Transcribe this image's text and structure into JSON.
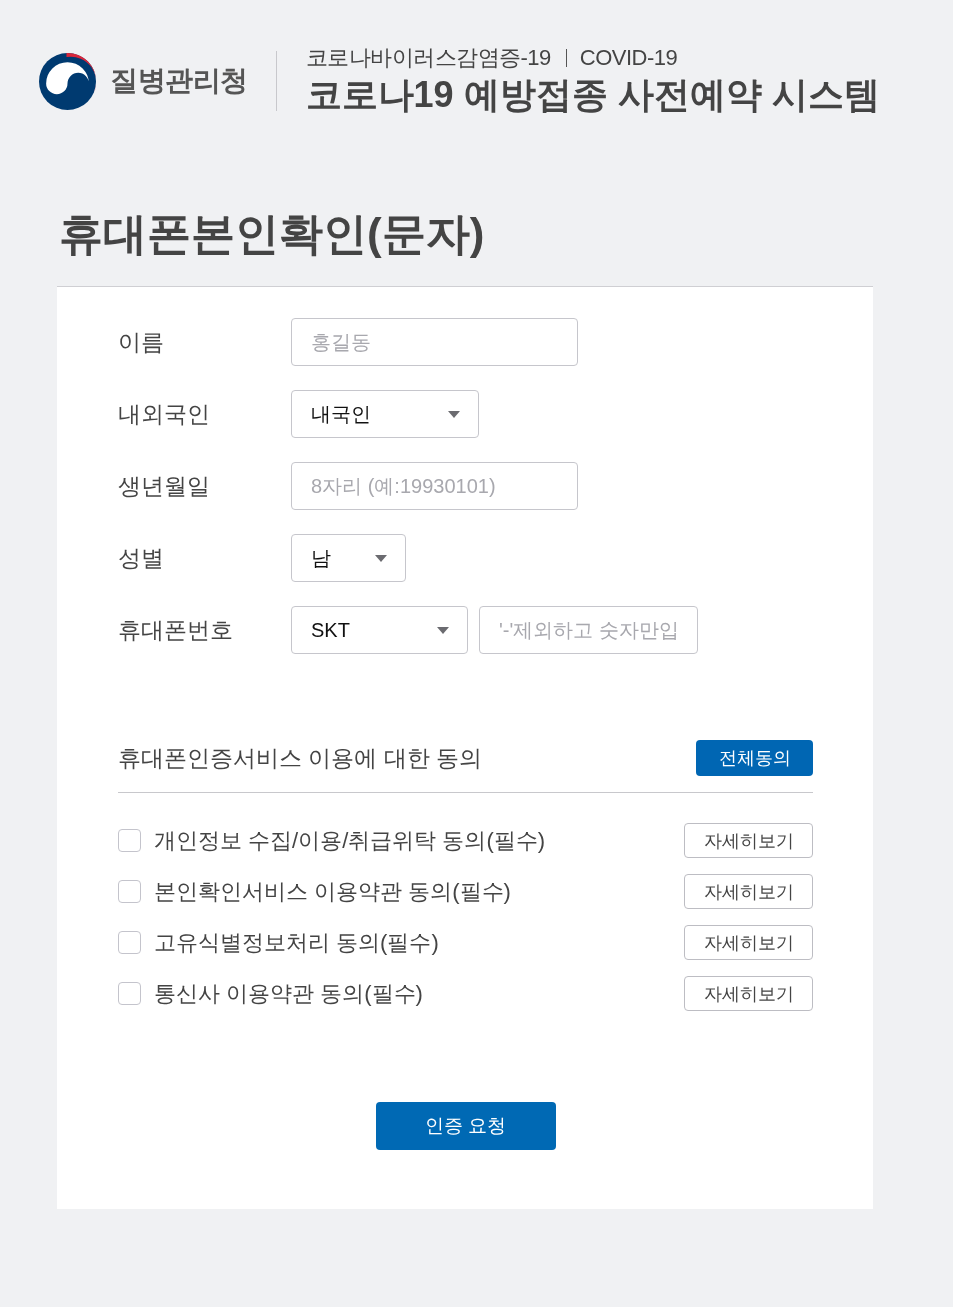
{
  "header": {
    "agency": "질병관리청",
    "subtitle": "코로나바이러스감염증-19",
    "subtitle_en": "COVID-19",
    "title": "코로나19 예방접종 사전예약 시스템"
  },
  "page_title": "휴대폰본인확인(문자)",
  "form": {
    "rows": [
      {
        "label": "이름",
        "fields": [
          {
            "kind": "input",
            "placeholder": "홍길동"
          }
        ]
      },
      {
        "label": "내외국인",
        "fields": [
          {
            "kind": "select",
            "value": "내국인"
          }
        ]
      },
      {
        "label": "생년월일",
        "fields": [
          {
            "kind": "input",
            "placeholder": "8자리 (예:19930101)"
          }
        ]
      },
      {
        "label": "성별",
        "fields": [
          {
            "kind": "select",
            "value": "남"
          }
        ]
      },
      {
        "label": "휴대폰번호",
        "fields": [
          {
            "kind": "select",
            "value": "SKT"
          },
          {
            "kind": "input",
            "placeholder": "'-'제외하고 숫자만입"
          }
        ]
      }
    ]
  },
  "consent": {
    "heading": "휴대폰인증서비스 이용에 대한 동의",
    "all_button": "전체동의",
    "items": [
      {
        "label": "개인정보 수집/이용/취급위탁 동의(필수)",
        "checked": false,
        "detail_button": "자세히보기"
      },
      {
        "label": "본인확인서비스 이용약관 동의(필수)",
        "checked": false,
        "detail_button": "자세히보기"
      },
      {
        "label": "고유식별정보처리 동의(필수)",
        "checked": false,
        "detail_button": "자세히보기"
      },
      {
        "label": "통신사 이용약관 동의(필수)",
        "checked": false,
        "detail_button": "자세히보기"
      }
    ]
  },
  "submit_button": "인증 요청"
}
